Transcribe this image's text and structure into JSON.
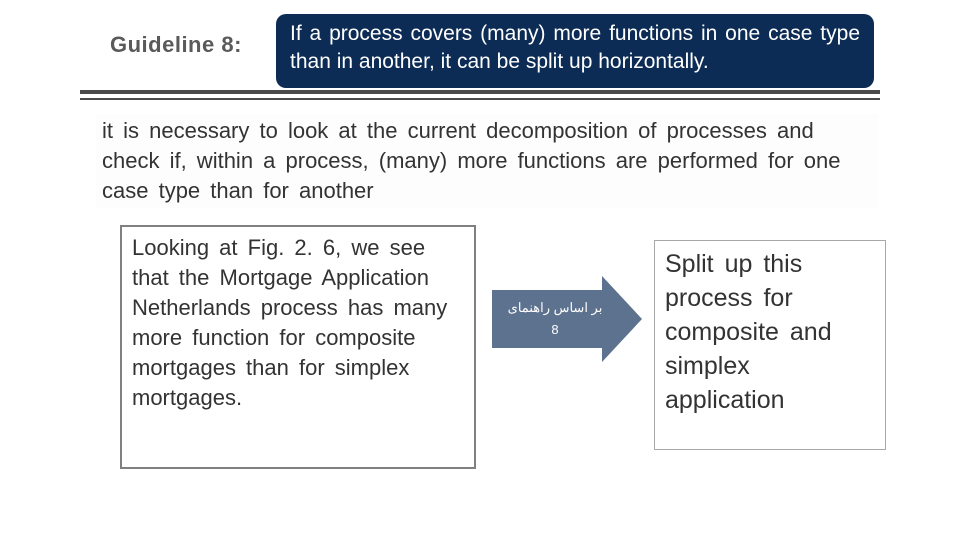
{
  "header": {
    "label": "Guideline 8:",
    "box_text": "If a process covers (many) more functions in one case type than in another, it can be split up horizontally."
  },
  "paragraph": "it is necessary to look at the current decomposition of processes and check if, within a process, (many) more functions are performed for one case type than for another",
  "example": "Looking at Fig. 2. 6, we see that the Mortgage Application Netherlands process has many more function for composite mortgages than for simplex mortgages.",
  "arrow": {
    "line": "بر اساس راهنمای",
    "num": "8"
  },
  "result": "Split up this process for composite and simplex application"
}
